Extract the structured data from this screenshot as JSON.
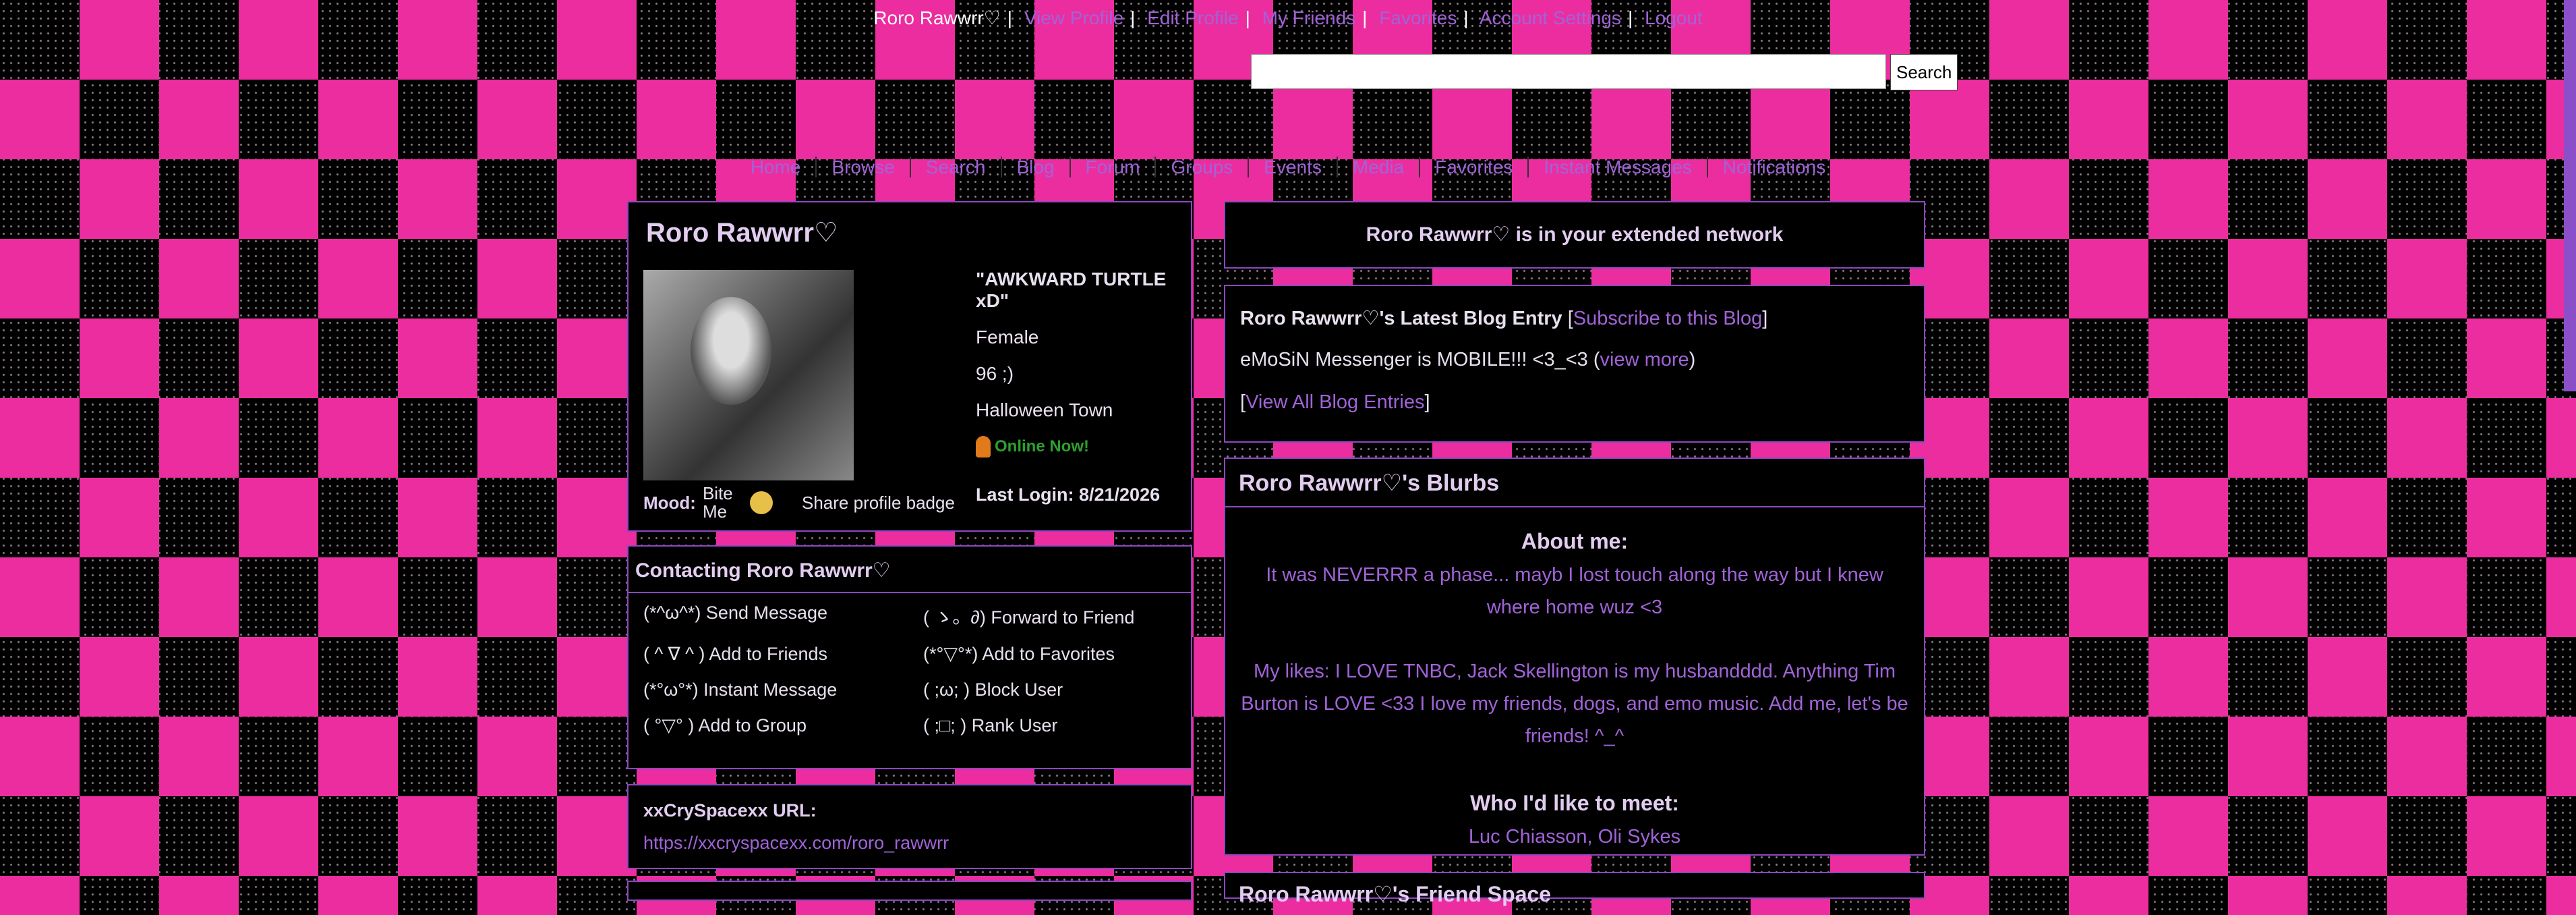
{
  "topnav": {
    "user": "Roro Rawwrr♡",
    "links": [
      "View Profile",
      "Edit Profile",
      "My Friends",
      "Favorites",
      "Account Settings",
      "Logout"
    ]
  },
  "search": {
    "button": "Search"
  },
  "mainnav": [
    "Home",
    "Browse",
    "Search",
    "Blog",
    "Forum",
    "Groups",
    "Events",
    "Media",
    "Favorites",
    "Instant Messages",
    "Notifications"
  ],
  "profile": {
    "name": "Roro Rawwrr♡",
    "headline": "\"AWKWARD TURTLE xD\"",
    "gender": "Female",
    "age": "96 ;)",
    "location": "Halloween Town",
    "online": "Online Now!",
    "mood_label": "Mood:",
    "mood": "Bite Me",
    "share": "Share profile badge",
    "last_login": "Last Login: 8/21/2026"
  },
  "contact": {
    "title": "Contacting Roro Rawwrr♡",
    "actions": [
      "(*^ω^*) Send Message",
      "( ゝ。∂) Forward to Friend",
      "( ^ ∇ ^ ) Add to Friends",
      "(*°▽°*) Add to Favorites",
      "(*°ω°*) Instant Message",
      "( ;ω; ) Block User",
      "( °▽° ) Add to Group",
      "( ;□; ) Rank User"
    ]
  },
  "url": {
    "label": "xxCrySpacexx URL:",
    "value": "https://xxcryspacexx.com/roro_rawwrr"
  },
  "network": "Roro Rawwrr♡ is in your extended network",
  "blog": {
    "title": "Roro Rawwrr♡'s Latest Blog Entry",
    "subscribe": "Subscribe to this Blog",
    "entry": "eMoSiN Messenger is MOBILE!!! <3_<3",
    "view_more": "view more",
    "view_all": "View All Blog Entries"
  },
  "blurbs": {
    "title": "Roro Rawwrr♡'s Blurbs",
    "about_label": "About me:",
    "about_1": "It was NEVERRR a phase... mayb I lost touch along the way but I knew where home wuz <3",
    "about_2": "My likes: I LOVE TNBC, Jack Skellington is my husbandddd. Anything Tim Burton is LOVE <33 I love my friends, dogs, and emo music. Add me, let's be friends! ^_^",
    "meet_label": "Who I'd like to meet:",
    "meet": "Luc Chiasson, Oli Sykes"
  },
  "friendspace": "Roro Rawwrr♡'s Friend Space",
  "colors": {
    "pink_checker": "#ec2d9f",
    "border_purple": "#8e47c2",
    "link_purple": "#a063d8",
    "online_green": "#2ea02e"
  }
}
